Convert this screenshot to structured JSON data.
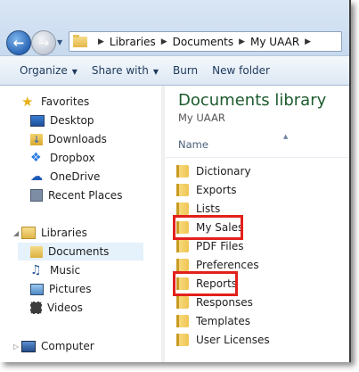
{
  "address_bar": {
    "breadcrumbs": [
      "Libraries",
      "Documents",
      "My UAAR"
    ]
  },
  "toolbar": {
    "organize_label": "Organize",
    "share_label": "Share with",
    "burn_label": "Burn",
    "new_folder_label": "New folder"
  },
  "nav": {
    "favorites_label": "Favorites",
    "favorites": [
      "Desktop",
      "Downloads",
      "Dropbox",
      "OneDrive",
      "Recent Places"
    ],
    "libraries_label": "Libraries",
    "libraries": [
      "Documents",
      "Music",
      "Pictures",
      "Videos"
    ],
    "computer_label": "Computer"
  },
  "content": {
    "title": "Documents library",
    "subtitle": "My UAAR",
    "column_name": "Name",
    "files": [
      "Dictionary",
      "Exports",
      "Lists",
      "My Sales",
      "PDF Files",
      "Preferences",
      "Reports",
      "Responses",
      "Templates",
      "User Licenses"
    ],
    "highlighted": [
      "My Sales",
      "Reports"
    ]
  },
  "colors": {
    "accent_title": "#1e5b2f",
    "highlight_box": "#e2211c",
    "selection": "#e5f1fb"
  }
}
